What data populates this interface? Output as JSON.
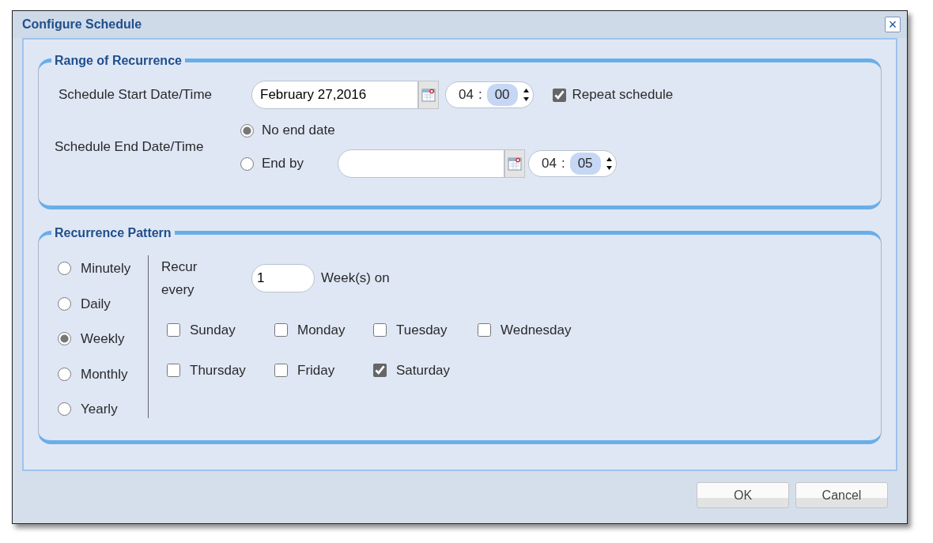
{
  "window": {
    "title": "Configure Schedule",
    "close": "×"
  },
  "range": {
    "legend": "Range of Recurrence",
    "start_label": "Schedule Start Date/Time",
    "start_date": "February 27,2016",
    "start_time": {
      "hour": "04",
      "separator": ":",
      "minute": "00"
    },
    "repeat": {
      "label": "Repeat schedule",
      "checked": true
    },
    "end_label": "Schedule End Date/Time",
    "end_options": [
      {
        "label": "No end date",
        "selected": true
      },
      {
        "label": "End by",
        "selected": false
      }
    ],
    "end_time": {
      "hour": "04",
      "separator": ":",
      "minute": "05"
    }
  },
  "pattern": {
    "legend": "Recurrence Pattern",
    "frequencies": [
      {
        "label": "Minutely",
        "selected": false
      },
      {
        "label": "Daily",
        "selected": false
      },
      {
        "label": "Weekly",
        "selected": true
      },
      {
        "label": "Monthly",
        "selected": false
      },
      {
        "label": "Yearly",
        "selected": false
      }
    ],
    "recur_label": "Recur every",
    "interval": "1",
    "interval_unit": "Week(s) on",
    "days": [
      {
        "label": "Sunday",
        "checked": false
      },
      {
        "label": "Monday",
        "checked": false
      },
      {
        "label": "Tuesday",
        "checked": false
      },
      {
        "label": "Wednesday",
        "checked": false
      },
      {
        "label": "Thursday",
        "checked": false
      },
      {
        "label": "Friday",
        "checked": false
      },
      {
        "label": "Saturday",
        "checked": true
      }
    ]
  },
  "buttons": [
    "OK",
    "Cancel"
  ]
}
